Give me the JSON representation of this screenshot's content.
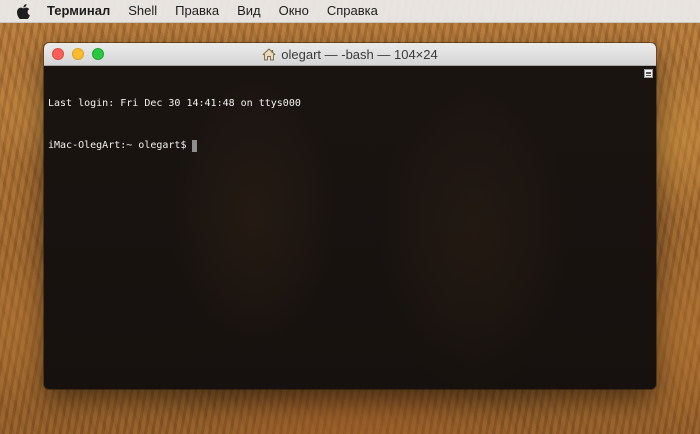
{
  "menubar": {
    "apple_icon": "apple-logo-icon",
    "items": [
      "Терминал",
      "Shell",
      "Правка",
      "Вид",
      "Окно",
      "Справка"
    ]
  },
  "window": {
    "title": "olegart — -bash — 104×24",
    "title_icon": "home-icon",
    "traffic_lights": {
      "close_color": "#fc5f57",
      "minimize_color": "#fdbc2e",
      "zoom_color": "#28c840"
    }
  },
  "terminal": {
    "lines": [
      "Last login: Fri Dec 30 14:41:48 on ttys000",
      "iMac-OlegArt:~ olegart$"
    ],
    "cursor_color": "#8e8e8e",
    "text_color": "#f2f2f2"
  }
}
